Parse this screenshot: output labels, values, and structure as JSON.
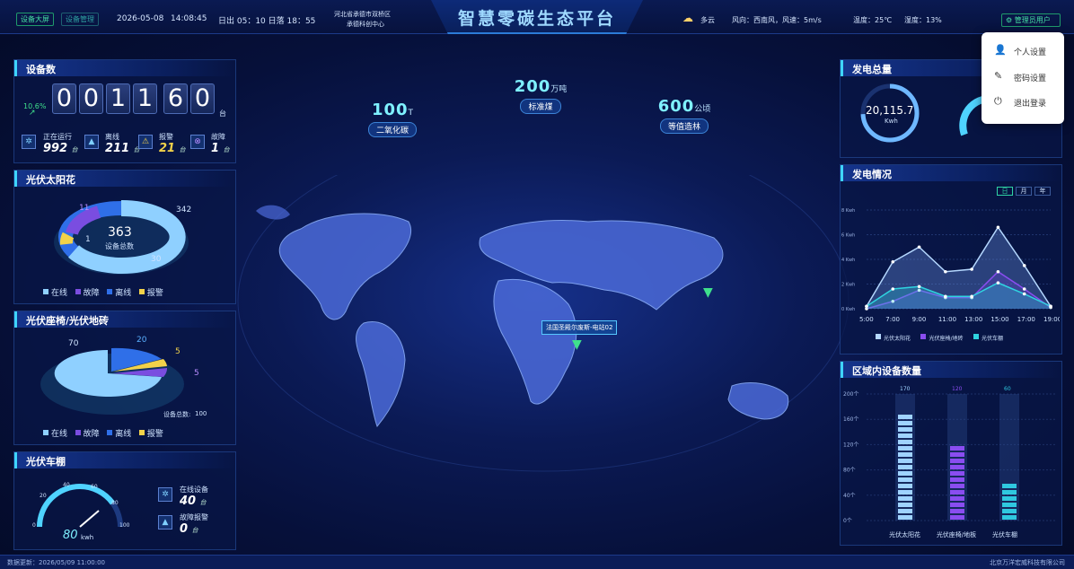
{
  "header": {
    "btn_dashboard": "设备大屏",
    "btn_manage": "设备管理",
    "date": "2026-05-08",
    "time": "14:08:45",
    "sun": "日出 05：10 日落 18：55",
    "location1": "河北省承德市双桥区",
    "location2": "承德科创中心",
    "title": "智慧零碳生态平台",
    "weather": "多云",
    "wind": "风向：西南风，风速：5m/s",
    "temp": "温度：25℃",
    "humidity": "湿度：13%",
    "admin": "管理员用户"
  },
  "menu": {
    "items": [
      {
        "label": "个人设置",
        "icon": "user-icon"
      },
      {
        "label": "密码设置",
        "icon": "edit-icon"
      },
      {
        "label": "退出登录",
        "icon": "power-icon"
      }
    ]
  },
  "device_count": {
    "title": "设备数",
    "pct": "10.6%",
    "digits": [
      "0",
      "0",
      "1",
      "1",
      "6",
      "0"
    ],
    "unit": "台",
    "stats": [
      {
        "label": "正在运行",
        "value": "992",
        "unit": "台"
      },
      {
        "label": "离线",
        "value": "211",
        "unit": "台"
      },
      {
        "label": "报警",
        "value": "21",
        "unit": "台"
      },
      {
        "label": "故障",
        "value": "1",
        "unit": "台"
      }
    ]
  },
  "pv_flower": {
    "title": "光伏太阳花",
    "total": "363",
    "total_label": "设备总数",
    "labels": {
      "online": "342",
      "fault": "11",
      "offline": "30",
      "alarm": "1"
    },
    "legend": [
      "在线",
      "故障",
      "离线",
      "报警"
    ]
  },
  "pv_bench": {
    "title": "光伏座椅/光伏地砖",
    "labels": {
      "online": "70",
      "offline": "20",
      "alarm": "5",
      "fault": "5"
    },
    "total_label": "设备总数:",
    "total": "100",
    "legend": [
      "在线",
      "故障",
      "离线",
      "报警"
    ]
  },
  "pv_carport": {
    "title": "光伏车棚",
    "gauge_value": "80",
    "gauge_unit": "kwh",
    "gauge_fill": 0.8,
    "ticks": [
      "0",
      "20",
      "40",
      "60",
      "80",
      "100"
    ],
    "stats": [
      {
        "label": "在线设备",
        "value": "40",
        "unit": "台"
      },
      {
        "label": "故障报警",
        "value": "0",
        "unit": "台"
      }
    ]
  },
  "emissions": [
    {
      "value": "100",
      "unit": "T",
      "label": "二氧化碳"
    },
    {
      "value": "200",
      "unit": "万吨",
      "label": "标准煤"
    },
    {
      "value": "600",
      "unit": "公顷",
      "label": "等值造林"
    }
  ],
  "map": {
    "marker_label": "法国圣殿尔废斯-电站02"
  },
  "gen_total": {
    "title": "发电总量",
    "value": "20,115.7",
    "unit": "Kwh"
  },
  "gen_status": {
    "title": "发电情况",
    "tabs": [
      "日",
      "月",
      "年"
    ],
    "legend": [
      "光伏太阳花",
      "光伏座椅/地砖",
      "光伏车棚"
    ]
  },
  "region": {
    "title": "区域内设备数量",
    "legend": [
      "光伏太阳花",
      "光伏座椅/地板",
      "光伏车棚"
    ]
  },
  "colors": {
    "accent": "#3fd5ff",
    "online": "#8fd0ff",
    "fault": "#7a4de0",
    "offline": "#2f6fe8",
    "alarm": "#f2d24a"
  },
  "footer": {
    "update": "数据更新：2026/05/09 11:00:00",
    "company": "北京万洋宏威科技有限公司"
  },
  "chart_data": [
    {
      "type": "area",
      "title": "发电情况",
      "x": [
        "5:00",
        "7:00",
        "9:00",
        "11:00",
        "13:00",
        "15:00",
        "17:00",
        "19:00"
      ],
      "yticks": [
        "0 Kwh",
        "2 Kwh",
        "4 Kwh",
        "6 Kwh",
        "8 Kwh"
      ],
      "ylim": [
        0,
        8
      ],
      "series": [
        {
          "name": "光伏太阳花",
          "values": [
            0.2,
            3.8,
            5.0,
            3.0,
            3.2,
            6.6,
            3.5,
            0.2
          ]
        },
        {
          "name": "光伏座椅/地砖",
          "values": [
            0,
            0.6,
            1.5,
            0.9,
            0.9,
            3.0,
            1.6,
            0.1
          ]
        },
        {
          "name": "光伏车棚",
          "values": [
            0.2,
            1.6,
            1.8,
            1.0,
            1.0,
            2.1,
            1.2,
            0.2
          ]
        }
      ]
    },
    {
      "type": "bar",
      "title": "区域内设备数量",
      "categories": [
        "光伏太阳花",
        "光伏座椅/地板",
        "光伏车棚"
      ],
      "values": [
        170,
        120,
        60
      ],
      "yticks": [
        "0个",
        "40个",
        "80个",
        "120个",
        "160个",
        "200个"
      ],
      "ylim": [
        0,
        200
      ]
    }
  ]
}
